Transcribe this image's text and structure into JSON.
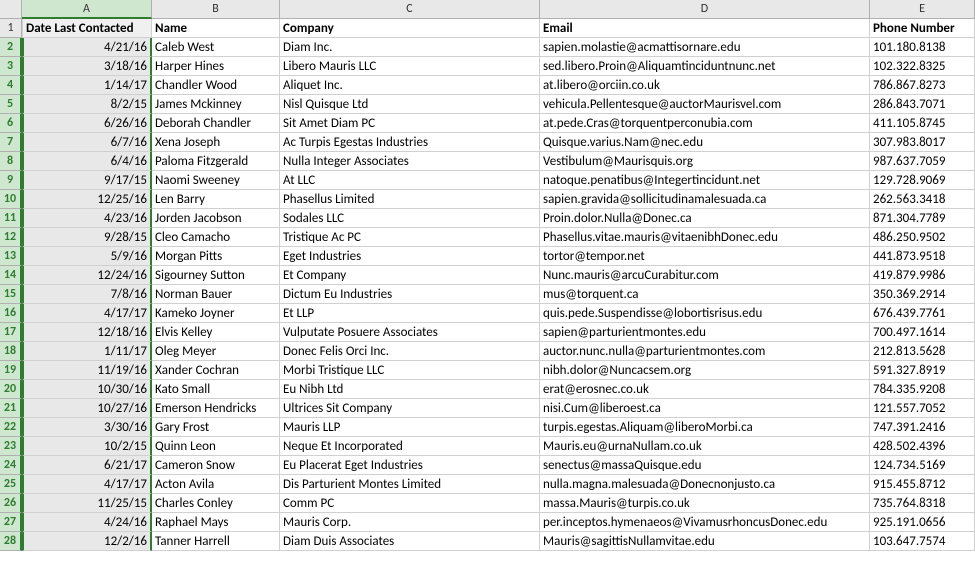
{
  "columns": [
    "A",
    "B",
    "C",
    "D",
    "E"
  ],
  "selected_column_index": 0,
  "headers": [
    "Date Last Contacted",
    "Name",
    "Company",
    "Email",
    "Phone Number"
  ],
  "rows": [
    {
      "n": 1,
      "date": "Date Last Contacted",
      "name": "Name",
      "company": "Company",
      "email": "Email",
      "phone": "Phone Number"
    },
    {
      "n": 2,
      "date": "4/21/16",
      "name": "Caleb West",
      "company": "Diam Inc.",
      "email": "sapien.molastie@acmattisornare.edu",
      "phone": "101.180.8138"
    },
    {
      "n": 3,
      "date": "3/18/16",
      "name": "Harper Hines",
      "company": "Libero Mauris LLC",
      "email": "sed.libero.Proin@Aliquamtinciduntnunc.net",
      "phone": "102.322.8325"
    },
    {
      "n": 4,
      "date": "1/14/17",
      "name": "Chandler Wood",
      "company": "Aliquet Inc.",
      "email": "at.libero@orciin.co.uk",
      "phone": "786.867.8273"
    },
    {
      "n": 5,
      "date": "8/2/15",
      "name": "James Mckinney",
      "company": "Nisl Quisque Ltd",
      "email": "vehicula.Pellentesque@auctorMaurisvel.com",
      "phone": "286.843.7071"
    },
    {
      "n": 6,
      "date": "6/26/16",
      "name": "Deborah Chandler",
      "company": "Sit Amet Diam PC",
      "email": "at.pede.Cras@torquentperconubia.com",
      "phone": "411.105.8745"
    },
    {
      "n": 7,
      "date": "6/7/16",
      "name": "Xena Joseph",
      "company": "Ac Turpis Egestas Industries",
      "email": "Quisque.varius.Nam@nec.edu",
      "phone": "307.983.8017"
    },
    {
      "n": 8,
      "date": "6/4/16",
      "name": "Paloma Fitzgerald",
      "company": "Nulla Integer Associates",
      "email": "Vestibulum@Maurisquis.org",
      "phone": "987.637.7059"
    },
    {
      "n": 9,
      "date": "9/17/15",
      "name": "Naomi Sweeney",
      "company": "At LLC",
      "email": "natoque.penatibus@Integertincidunt.net",
      "phone": "129.728.9069"
    },
    {
      "n": 10,
      "date": "12/25/16",
      "name": "Len Barry",
      "company": "Phasellus Limited",
      "email": "sapien.gravida@sollicitudinamalesuada.ca",
      "phone": "262.563.3418"
    },
    {
      "n": 11,
      "date": "4/23/16",
      "name": "Jorden Jacobson",
      "company": "Sodales LLC",
      "email": "Proin.dolor.Nulla@Donec.ca",
      "phone": "871.304.7789"
    },
    {
      "n": 12,
      "date": "9/28/15",
      "name": "Cleo Camacho",
      "company": "Tristique Ac PC",
      "email": "Phasellus.vitae.mauris@vitaenibhDonec.edu",
      "phone": "486.250.9502"
    },
    {
      "n": 13,
      "date": "5/9/16",
      "name": "Morgan Pitts",
      "company": "Eget Industries",
      "email": "tortor@tempor.net",
      "phone": "441.873.9518"
    },
    {
      "n": 14,
      "date": "12/24/16",
      "name": "Sigourney Sutton",
      "company": "Et Company",
      "email": "Nunc.mauris@arcuCurabitur.com",
      "phone": "419.879.9986"
    },
    {
      "n": 15,
      "date": "7/8/16",
      "name": "Norman Bauer",
      "company": "Dictum Eu Industries",
      "email": "mus@torquent.ca",
      "phone": "350.369.2914"
    },
    {
      "n": 16,
      "date": "4/17/17",
      "name": "Kameko Joyner",
      "company": "Et LLP",
      "email": "quis.pede.Suspendisse@lobortisrisus.edu",
      "phone": "676.439.7761"
    },
    {
      "n": 17,
      "date": "12/18/16",
      "name": "Elvis Kelley",
      "company": "Vulputate Posuere Associates",
      "email": "sapien@parturientmontes.edu",
      "phone": "700.497.1614"
    },
    {
      "n": 18,
      "date": "1/11/17",
      "name": "Oleg Meyer",
      "company": "Donec Felis Orci Inc.",
      "email": "auctor.nunc.nulla@parturientmontes.com",
      "phone": "212.813.5628"
    },
    {
      "n": 19,
      "date": "11/19/16",
      "name": "Xander Cochran",
      "company": "Morbi Tristique LLC",
      "email": "nibh.dolor@Nuncacsem.org",
      "phone": "591.327.8919"
    },
    {
      "n": 20,
      "date": "10/30/16",
      "name": "Kato Small",
      "company": "Eu Nibh Ltd",
      "email": "erat@erosnec.co.uk",
      "phone": "784.335.9208"
    },
    {
      "n": 21,
      "date": "10/27/16",
      "name": "Emerson Hendricks",
      "company": "Ultrices Sit Company",
      "email": "nisi.Cum@liberoest.ca",
      "phone": "121.557.7052"
    },
    {
      "n": 22,
      "date": "3/30/16",
      "name": "Gary Frost",
      "company": "Mauris LLP",
      "email": "turpis.egestas.Aliquam@liberoMorbi.ca",
      "phone": "747.391.2416"
    },
    {
      "n": 23,
      "date": "10/2/15",
      "name": "Quinn Leon",
      "company": "Neque Et Incorporated",
      "email": "Mauris.eu@urnaNullam.co.uk",
      "phone": "428.502.4396"
    },
    {
      "n": 24,
      "date": "6/21/17",
      "name": "Cameron Snow",
      "company": "Eu Placerat Eget Industries",
      "email": "senectus@massaQuisque.edu",
      "phone": "124.734.5169"
    },
    {
      "n": 25,
      "date": "4/17/17",
      "name": "Acton Avila",
      "company": "Dis Parturient Montes Limited",
      "email": "nulla.magna.malesuada@Donecnonjusto.ca",
      "phone": "915.455.8712"
    },
    {
      "n": 26,
      "date": "11/25/15",
      "name": "Charles Conley",
      "company": "Comm PC",
      "email": "massa.Mauris@turpis.co.uk",
      "phone": "735.764.8318"
    },
    {
      "n": 27,
      "date": "4/24/16",
      "name": "Raphael Mays",
      "company": "Mauris Corp.",
      "email": "per.inceptos.hymenaeos@VivamusrhoncusDonec.edu",
      "phone": "925.191.0656"
    },
    {
      "n": 28,
      "date": "12/2/16",
      "name": "Tanner Harrell",
      "company": "Diam Duis Associates",
      "email": "Mauris@sagittisNullamvitae.edu",
      "phone": "103.647.7574"
    }
  ]
}
